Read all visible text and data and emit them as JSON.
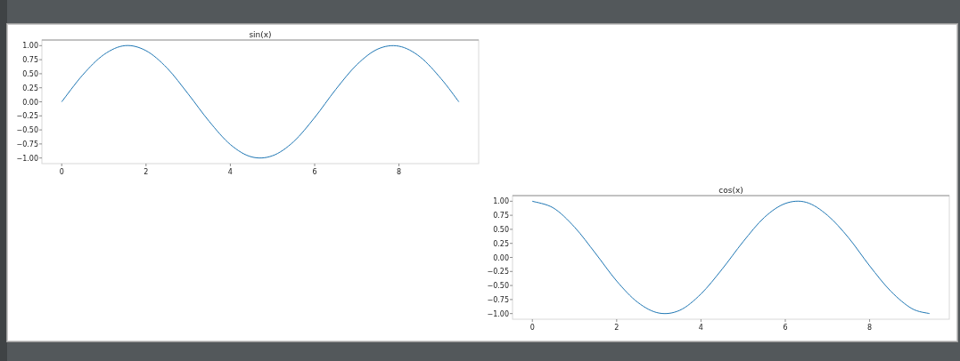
{
  "figure": {
    "subplots": [
      {
        "chart_data": {
          "type": "line",
          "title": "sin(x)",
          "x": [
            0,
            0.5,
            1,
            1.5,
            2,
            2.5,
            3,
            3.5,
            4,
            4.5,
            5,
            5.5,
            6,
            6.5,
            7,
            7.5,
            8,
            8.5,
            9,
            9.42
          ],
          "series": [
            {
              "color": "#1f77b4",
              "values": [
                0,
                0.48,
                0.84,
                1,
                0.91,
                0.6,
                0.14,
                -0.35,
                -0.76,
                -0.98,
                -0.96,
                -0.71,
                -0.28,
                0.22,
                0.66,
                0.94,
                0.99,
                0.8,
                0.41,
                0
              ]
            }
          ],
          "xlim": [
            -0.47,
            9.89
          ],
          "ylim": [
            -1.1,
            1.1
          ],
          "xticks": [
            0,
            2,
            4,
            6,
            8
          ],
          "yticks": [
            {
              "value": -1,
              "label": "−1.00"
            },
            {
              "value": -0.75,
              "label": "−0.75"
            },
            {
              "value": -0.5,
              "label": "−0.50"
            },
            {
              "value": -0.25,
              "label": "−0.25"
            },
            {
              "value": 0,
              "label": "0.00"
            },
            {
              "value": 0.25,
              "label": "0.25"
            },
            {
              "value": 0.5,
              "label": "0.50"
            },
            {
              "value": 0.75,
              "label": "0.75"
            },
            {
              "value": 1,
              "label": "1.00"
            }
          ]
        }
      },
      {
        "chart_data": {
          "type": "line",
          "title": "cos(x)",
          "x": [
            0,
            0.5,
            1,
            1.5,
            2,
            2.5,
            3,
            3.5,
            4,
            4.5,
            5,
            5.5,
            6,
            6.5,
            7,
            7.5,
            8,
            8.5,
            9,
            9.42
          ],
          "series": [
            {
              "color": "#1f77b4",
              "values": [
                1,
                0.88,
                0.54,
                0.07,
                -0.42,
                -0.8,
                -0.99,
                -0.94,
                -0.65,
                -0.21,
                0.28,
                0.71,
                0.96,
                0.98,
                0.75,
                0.35,
                -0.15,
                -0.6,
                -0.91,
                -1
              ]
            }
          ],
          "xlim": [
            -0.47,
            9.89
          ],
          "ylim": [
            -1.1,
            1.1
          ],
          "xticks": [
            0,
            2,
            4,
            6,
            8
          ],
          "yticks": [
            {
              "value": -1,
              "label": "−1.00"
            },
            {
              "value": -0.75,
              "label": "−0.75"
            },
            {
              "value": -0.5,
              "label": "−0.50"
            },
            {
              "value": -0.25,
              "label": "−0.25"
            },
            {
              "value": 0,
              "label": "0.00"
            },
            {
              "value": 0.25,
              "label": "0.25"
            },
            {
              "value": 0.5,
              "label": "0.50"
            },
            {
              "value": 0.75,
              "label": "0.75"
            },
            {
              "value": 1,
              "label": "1.00"
            }
          ]
        }
      }
    ]
  }
}
